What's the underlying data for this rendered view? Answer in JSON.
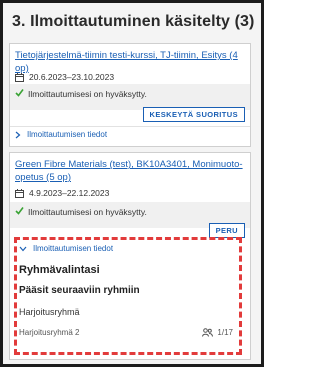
{
  "page": {
    "heading": "3. Ilmoittautuminen käsitelty (3)"
  },
  "enrollments": [
    {
      "course": "Tietojärjestelmä-tiimin testi-kurssi, TJ-tiimin, Esitys (4 op)",
      "dates": "20.6.2023–23.10.2023",
      "status": "Ilmoittautumisesi on hyväksytty.",
      "action": "KESKEYTÄ SUORITUS",
      "details_toggle": "Ilmoittautumisen tiedot"
    },
    {
      "course": "Green Fibre Materials (test), BK10A3401, Monimuoto-opetus (5 op)",
      "dates": "4.9.2023–22.12.2023",
      "status": "Ilmoittautumisesi on hyväksytty.",
      "action": "PERU",
      "details_toggle": "Ilmoittautumisen tiedot",
      "details": {
        "section_title": "Ryhmävalintasi",
        "subtitle": "Pääsit seuraaviin ryhmiin",
        "group_type": "Harjoitusryhmä",
        "group_name": "Harjoitusryhmä 2",
        "seats": "1/17"
      }
    }
  ],
  "colors": {
    "link": "#1a5fb4",
    "success": "#3aa335",
    "highlight": "#e23b3b"
  },
  "icons": [
    "calendar-icon",
    "check-icon",
    "chevron-right-icon",
    "chevron-down-icon",
    "people-icon"
  ]
}
